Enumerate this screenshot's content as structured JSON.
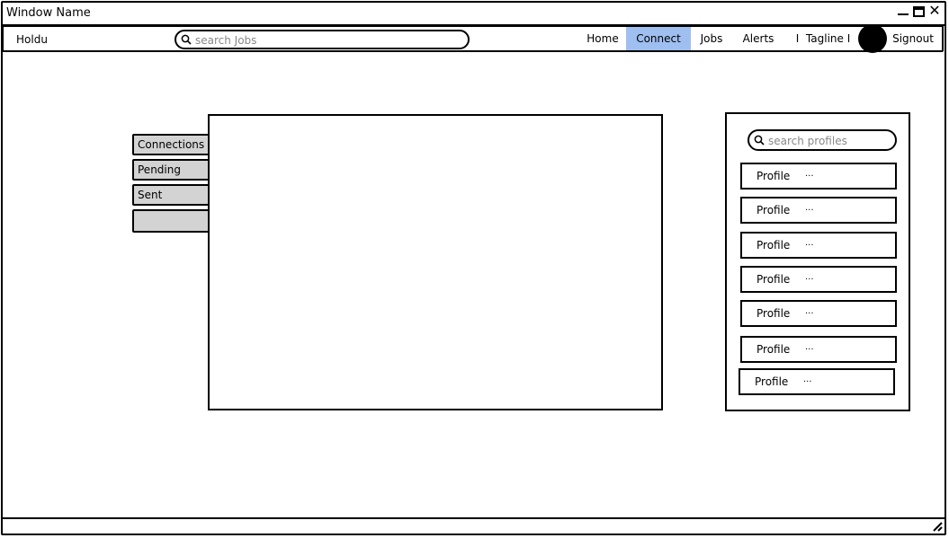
{
  "window": {
    "title": "Window Name"
  },
  "nav": {
    "brand": "Holdu",
    "search_placeholder": "search Jobs",
    "items": [
      {
        "label": "Home"
      },
      {
        "label": "Connect",
        "active": true
      },
      {
        "label": "Jobs"
      },
      {
        "label": "Alerts"
      },
      {
        "label": "I  Tagline I"
      },
      {
        "label": "Signout"
      }
    ]
  },
  "tabs": [
    {
      "label": "Connections"
    },
    {
      "label": "Pending"
    },
    {
      "label": "Sent"
    },
    {
      "label": ""
    }
  ],
  "profiles_panel": {
    "search_placeholder": "search profiles",
    "profiles": [
      {
        "label": "Profile",
        "more": "..."
      },
      {
        "label": "Profile",
        "more": "..."
      },
      {
        "label": "Profile",
        "more": "..."
      },
      {
        "label": "Profile",
        "more": "..."
      },
      {
        "label": "Profile",
        "more": "..."
      },
      {
        "label": "Profile",
        "more": "..."
      },
      {
        "label": "Profile",
        "more": "..."
      }
    ]
  },
  "colors": {
    "active_nav": "#9fbff0",
    "tab_background": "#d3d3d3"
  }
}
